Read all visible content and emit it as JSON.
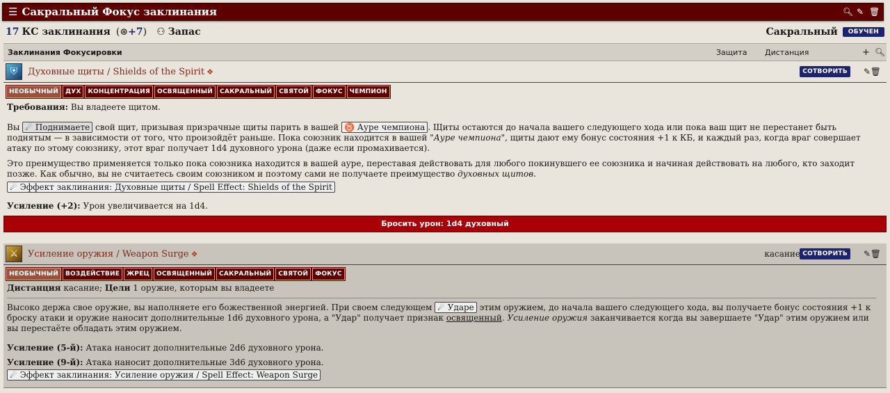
{
  "window": {
    "title": "Сакральный Фокус заклинания"
  },
  "stats": {
    "dc_value": "17",
    "dc_label": "КС заклинания",
    "attack_mod": "+7",
    "pool_label": "Запас",
    "tradition": "Сакральный",
    "learned": "ОБУЧЕН"
  },
  "section": {
    "name": "Заклинания Фокусировки",
    "col_defense": "Защита",
    "col_range": "Дистанция"
  },
  "spell1": {
    "name": "Духовные щиты / Shields of the Spirit",
    "cast": "СОТВОРИТЬ",
    "tags": [
      "НЕОБЫЧНЫЙ",
      "ДУХ",
      "КОНЦЕНТРАЦИЯ",
      "ОСВЯЩЕННЫЙ",
      "САКРАЛЬНЫЙ",
      "СВЯТОЙ",
      "ФОКУС",
      "ЧЕМПИОН"
    ],
    "req_label": "Требования:",
    "req_text": " Вы владеете щитом.",
    "p1_a": "Вы ",
    "p1_raise": "Поднимаете",
    "p1_b": " свой щит, призывая призрачные щиты парить в вашей ",
    "p1_aura": "Ауре чемпиона",
    "p1_c": ". Щиты остаются до начала вашего следующего хода или пока ваш щит не перестанет быть поднятым — в зависимости от того, что произойдёт раньше. Пока союзник находится в вашей ",
    "p1_aura_i": "\"Ауре чемпиона\"",
    "p1_d": ", щиты дают ему бонус состояния +1 к КБ, и каждый раз, когда враг совершает атаку по этому союзнику, этот враг получает 1d4 духовного урона (даже если промахивается).",
    "p2_a": "Это преимущество применяется только пока союзника находится в вашей ауре, переставая действовать для любого покинувшего ее союзника и начиная действовать на любого, кто заходит позже. Как обычно, вы не считаетесь своим союзником и поэтому сами не получаете преимущество ",
    "p2_i": "духовных щитов",
    "p2_b": ".",
    "effect": "Эффект заклинания: Духовные щиты / Spell Effect: Shields of the Spirit",
    "heighten_label": "Усиление (+2):",
    "heighten_text": " Урон увеличивается на 1d4.",
    "damage_button": "Бросить урон: 1d4 духовный"
  },
  "spell2": {
    "name": "Усиление оружия / Weapon Surge",
    "range": "касание",
    "cast": "СОТВОРИТЬ",
    "tags": [
      "НЕОБЫЧНЫЙ",
      "ВОЗДЕЙСТВИЕ",
      "ЖРЕЦ",
      "ОСВЯЩЕННЫЙ",
      "САКРАЛЬНЫЙ",
      "СВЯТОЙ",
      "ФОКУС"
    ],
    "range_label": "Дистанция",
    "range_text": " касание; ",
    "targets_label": "Цели",
    "targets_text": " 1 оружие, которым вы владеете",
    "p1_a": "Высоко держа свое оружие, вы наполняете его божественной энергией. При своем следующем ",
    "p1_strike": "Ударе",
    "p1_b": " этим оружием, до начала вашего следующего хода, вы получаете бонус состояния +1 к броску атаки и оружие наносит дополнительные 1d6 духовного урона, а \"Удар\" получает признак ",
    "p1_link": "освященный",
    "p1_c": ". ",
    "p1_i": "Усиление оружия",
    "p1_d": " заканчивается когда вы завершаете \"Удар\" этим оружием или вы перестаёте обладать этим оружием.",
    "h5_label": "Усиление (5-й):",
    "h5_text": " Атака наносит дополнительные 2d6 духовного урона.",
    "h9_label": "Усиление (9-й):",
    "h9_text": " Атака наносит дополнительные 3d6 духовного урона.",
    "effect": "Эффект заклинания: Усиление оружия / Spell Effect: Weapon Surge"
  },
  "colors": {
    "title_bg": "#5e0000",
    "tag_bg": "#5e0000",
    "button_blue": "#1c2470",
    "damage_red": "#a90008"
  },
  "icons": [
    "menu-icon",
    "search-icon",
    "edit-icon",
    "trash-icon",
    "pool-icon",
    "add-icon",
    "shield-spirit-icon",
    "weapon-surge-icon",
    "action-icon",
    "effect-icon",
    "aura-icon"
  ]
}
